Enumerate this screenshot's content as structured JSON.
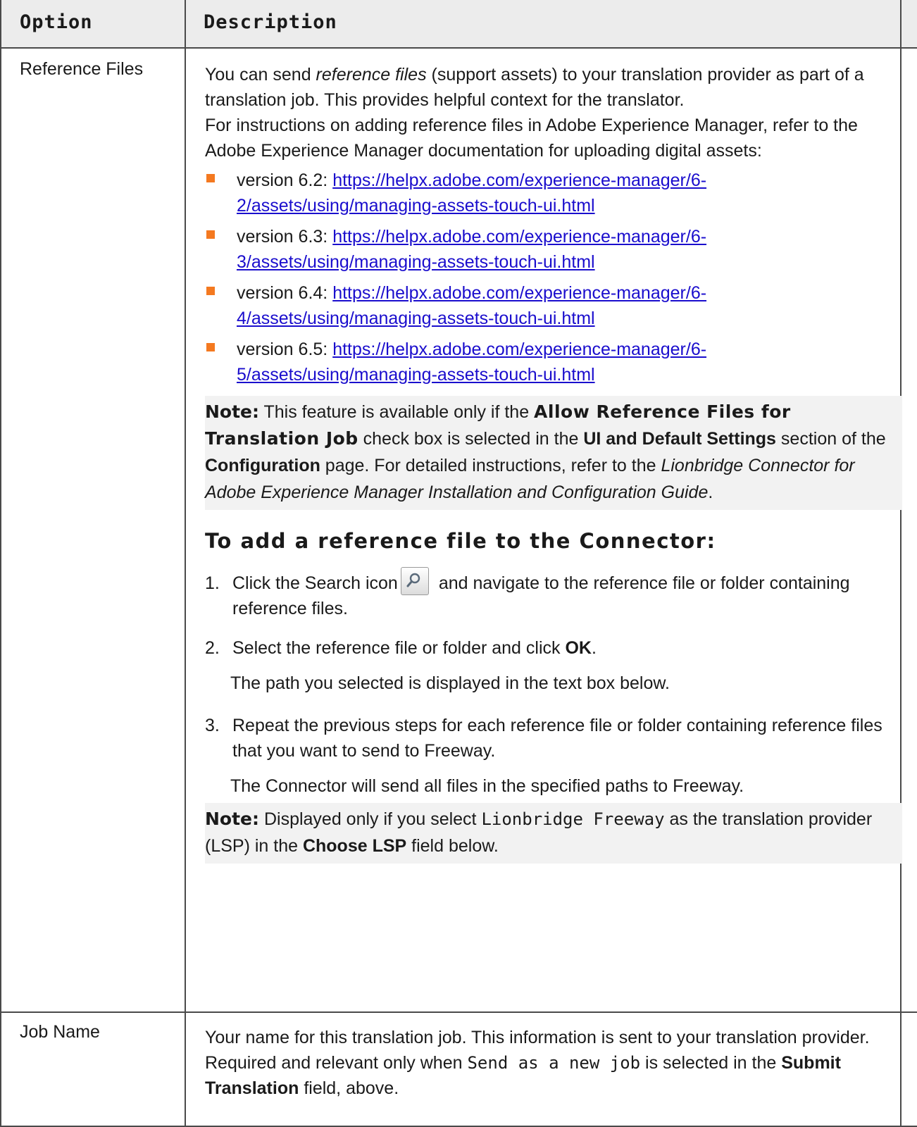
{
  "table": {
    "header": {
      "option": "Option",
      "description": "Description"
    },
    "row1": {
      "option": "Reference Files",
      "intro1_a": "You can send ",
      "intro1_em": "reference files",
      "intro1_b": " (support assets) to your translation provider as part of a translation job. This provides helpful context for the translator.",
      "intro2": "For instructions on adding reference files in Adobe Experience Manager, refer to the Adobe Experience Manager documentation for uploading digital assets:",
      "versions": [
        {
          "label": "version 6.2: ",
          "url": "https://helpx.adobe.com/experience-manager/6-2/assets/using/managing-assets-touch-ui.html"
        },
        {
          "label": "version 6.3: ",
          "url": "https://helpx.adobe.com/experience-manager/6-3/assets/using/managing-assets-touch-ui.html"
        },
        {
          "label": "version 6.4: ",
          "url": "https://helpx.adobe.com/experience-manager/6-4/assets/using/managing-assets-touch-ui.html"
        },
        {
          "label": "version 6.5: ",
          "url": "https://helpx.adobe.com/experience-manager/6-5/assets/using/managing-assets-touch-ui.html"
        }
      ],
      "note1": {
        "label": "Note:",
        "t1": " This feature is available only if the ",
        "ui1": "Allow Reference Files for Translation Job",
        "t2": " check box is selected in the ",
        "b1": "UI and Default Settings",
        "t3": " section of the ",
        "b2": "Configuration",
        "t4": " page. For detailed instructions, refer to the ",
        "guide": "Lionbridge Connector for Adobe Experience Manager Installation and Configuration Guide",
        "t5": "."
      },
      "proc_title": "To add a reference file to the Connector:",
      "step1": {
        "num": "1.",
        "a": "Click the Search icon",
        "b": "and navigate to the reference file or folder containing reference files."
      },
      "step2": {
        "num": "2.",
        "a": "Select the reference file or folder and click ",
        "b": "OK",
        "c": ".",
        "sub": "The path you selected is displayed in the text box below."
      },
      "step3": {
        "num": "3.",
        "a": "Repeat the previous steps for each reference file or folder containing reference files that you want to send to Freeway.",
        "sub": "The Connector will send all files in the specified paths to Freeway."
      },
      "note2": {
        "label": "Note:",
        "t1": " Displayed only if you select ",
        "code": "Lionbridge Freeway",
        "t2": " as the translation provider (LSP) in the ",
        "b1": "Choose LSP",
        "t3": " field below."
      }
    },
    "row2": {
      "option": "Job Name",
      "line1": "Your name for this translation job. This information is sent to your translation provider.",
      "l2a": "Required and relevant only when ",
      "code": "Send as a new job",
      "l2b": " is selected in the ",
      "b1": "Submit Translation",
      "l2c": " field, above."
    }
  },
  "colors": {
    "link": "#1a0dcd",
    "bullet": "#f47920",
    "header_bg": "#ececec",
    "note_bg": "#f2f2f2"
  }
}
